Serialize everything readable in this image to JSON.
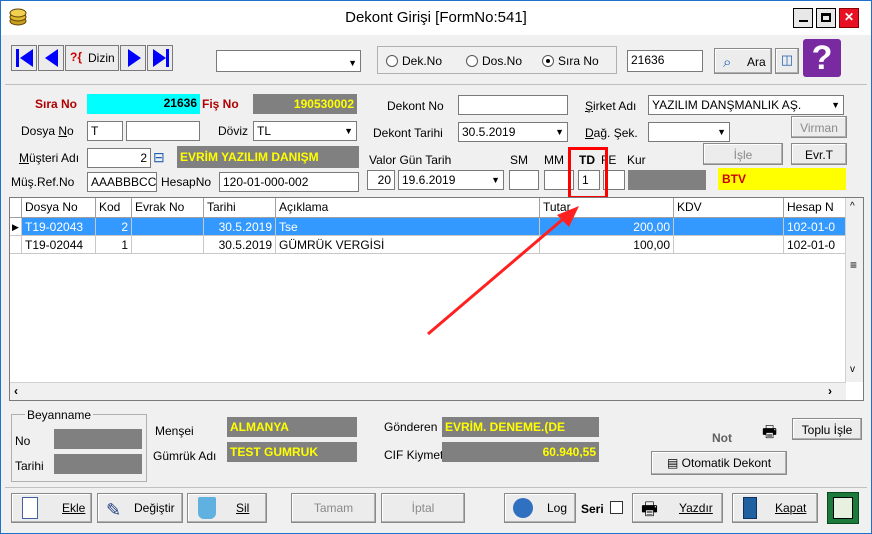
{
  "window": {
    "title": "Dekont Girişi [FormNo:541]",
    "min_label": "—",
    "max_label": "□",
    "close_label": "✕"
  },
  "toolbar": {
    "dizin_prefix": "?{",
    "dizin_label": "Dizin",
    "combo_value": "",
    "radio_dekno": "Dek.No",
    "radio_dosno": "Dos.No",
    "radio_sirano": "Sıra No",
    "radio_selected": "sirano",
    "search_value": "21636",
    "ara_label": "Ara",
    "help_label": "?"
  },
  "form": {
    "sira_no_label": "Sıra No",
    "sira_no_value": "21636",
    "fis_no_label": "Fiş No",
    "fis_no_value": "190530002",
    "dosya_no_label": "Dosya No",
    "dosya_no_value": "T",
    "dosya_no_value2": "",
    "doviz_label": "Döviz",
    "doviz_value": "TL",
    "musteri_adi_label": "Müşteri Adı",
    "musteri_adi_code": "2",
    "musteri_adi_name": "EVRİM YAZILIM DANIŞM",
    "mus_ref_label": "Müş.Ref.No",
    "mus_ref_value": "AAABBBCC",
    "hesap_no_label": "HesapNo",
    "hesap_no_value": "120-01-000-002",
    "dekont_no_label": "Dekont No",
    "dekont_no_value": "",
    "dekont_tarihi_label": "Dekont Tarihi",
    "dekont_tarihi_value": "30.5.2019",
    "valor_label": "Valor Gün Tarih",
    "valor_gun": "20",
    "valor_tarih": "19.6.2019",
    "sm_label": "SM",
    "mm_label": "MM",
    "td_label": "TD",
    "fe_label": "FE",
    "kur_label": "Kur",
    "td_value": "1",
    "sirket_adi_label": "Şirket Adı",
    "sirket_adi_value": "YAZILIM DANŞMANLIK AŞ.",
    "dag_sek_label": "Dağ. Şek.",
    "dag_sek_value": "",
    "virman_label": "Virman",
    "isle_label": "İşle",
    "evrt_label": "Evr.T",
    "btv_label": "BTV"
  },
  "grid": {
    "columns": [
      "Dosya No",
      "Kod",
      "Evrak No",
      "Tarihi",
      "Açıklama",
      "Tutar",
      "KDV",
      "Hesap N"
    ],
    "rows": [
      [
        "T19-02043",
        "2",
        "",
        "30.5.2019",
        "Tse",
        "200,00",
        "",
        "102-01-0"
      ],
      [
        "T19-02044",
        "1",
        "",
        "30.5.2019",
        "GÜMRÜK VERGİSİ",
        "100,00",
        "",
        "102-01-0"
      ]
    ]
  },
  "beyanname": {
    "title": "Beyanname",
    "no_label": "No",
    "tarihi_label": "Tarihi",
    "mensei_label": "Menşei",
    "mensei_value": "ALMANYA",
    "gumruk_adi_label": "Gümrük Adı",
    "gumruk_adi_value": "TEST GUMRUK",
    "gonderen_label": "Gönderen",
    "gonderen_value": "EVRİM. DENEME.(DE",
    "cif_label": "CIF Kiymet",
    "cif_value": "60.940,55",
    "not_label": "Not",
    "toplu_isle_label": "Toplu İşle",
    "otomatik_label": "Otomatik Dekont"
  },
  "bottom": {
    "ekle": "Ekle",
    "degistir": "Değiştir",
    "sil": "Sil",
    "tamam": "Tamam",
    "iptal": "İptal",
    "log": "Log",
    "seri": "Seri",
    "yazdir": "Yazdır",
    "kapat": "Kapat"
  },
  "colors": {
    "accent_cyan": "#00ffff",
    "highlight_red": "#ff0000",
    "selection_blue": "#3399ff",
    "yellow_text": "#ffff00"
  }
}
